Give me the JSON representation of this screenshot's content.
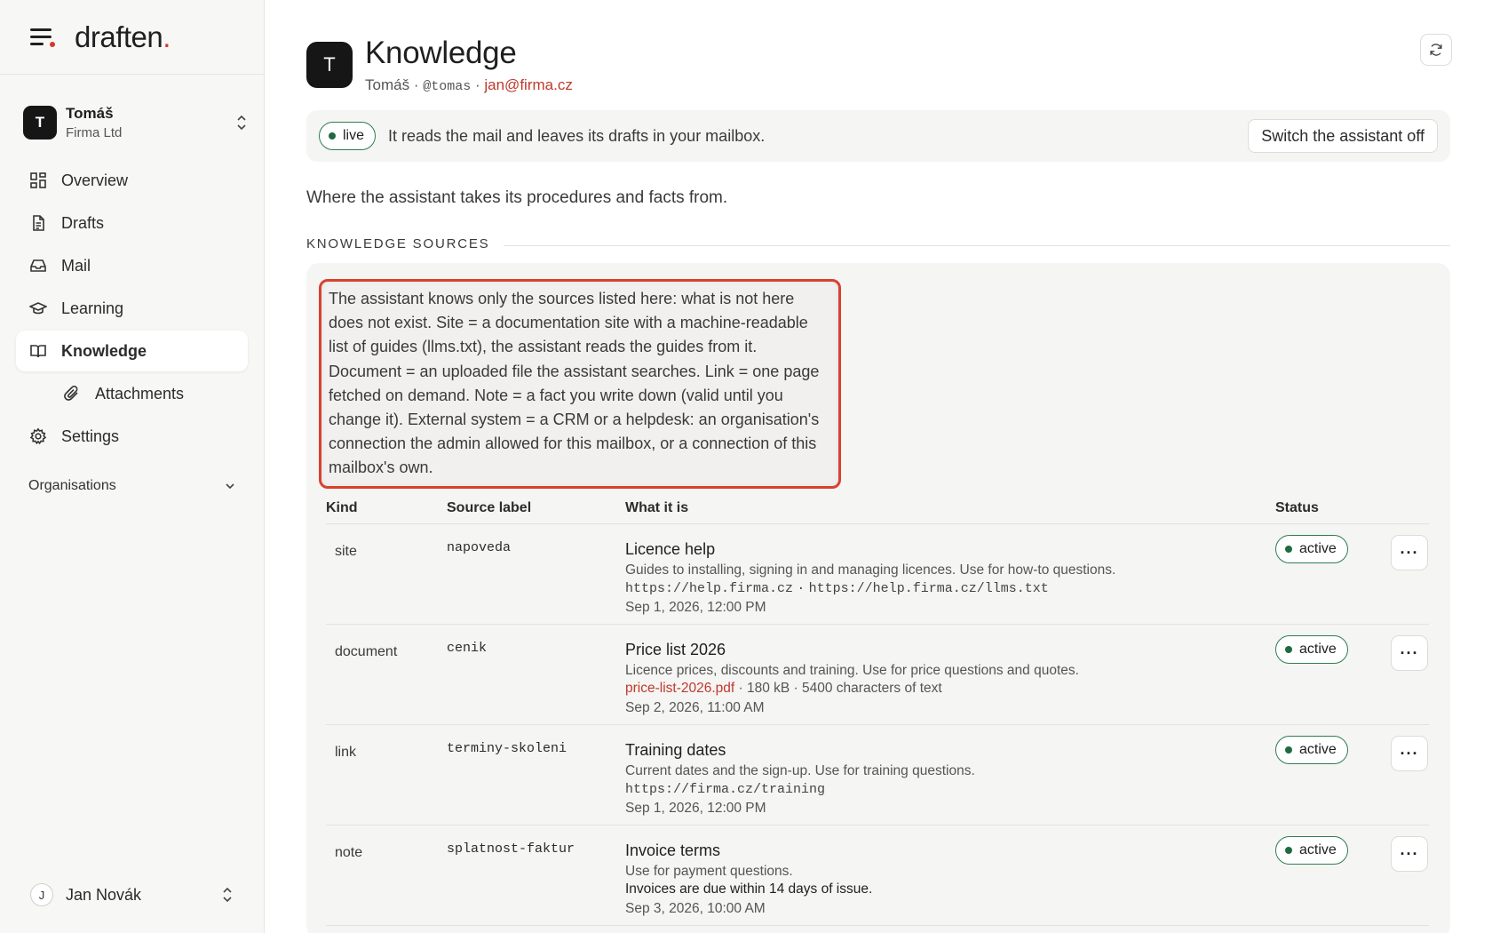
{
  "brand": {
    "name": "draften",
    "dot": "."
  },
  "account": {
    "initial": "T",
    "name": "Tomáš",
    "org": "Firma Ltd"
  },
  "nav": {
    "overview": "Overview",
    "drafts": "Drafts",
    "mail": "Mail",
    "learning": "Learning",
    "knowledge": "Knowledge",
    "attachments": "Attachments",
    "settings": "Settings",
    "organisations": "Organisations"
  },
  "user": {
    "initial": "J",
    "name": "Jan Novák"
  },
  "page": {
    "initial": "T",
    "title": "Knowledge",
    "owner": "Tomáš",
    "sep1": "·",
    "handle": "@tomas",
    "sep2": "·",
    "email": "jan@firma.cz"
  },
  "live": {
    "badge": "live",
    "text": "It reads the mail and leaves its drafts in your mailbox.",
    "switch_label": "Switch the assistant off"
  },
  "lead": "Where the assistant takes its procedures and facts from.",
  "section_label": "KNOWLEDGE SOURCES",
  "note": "The assistant knows only the sources listed here: what is not here does not exist. Site = a documentation site with a machine-readable list of guides (llms.txt), the assistant reads the guides from it. Document = an uploaded file the assistant searches. Link = one page fetched on demand. Note = a fact you write down (valid until you change it). External system = a CRM or a helpdesk: an organisation's connection the admin allowed for this mailbox, or a connection of this mailbox's own.",
  "table": {
    "headers": {
      "kind": "Kind",
      "label": "Source label",
      "what": "What it is",
      "status": "Status"
    },
    "rows": [
      {
        "kind": "site",
        "label": "napoveda",
        "title": "Licence help",
        "desc": "Guides to installing, signing in and managing licences. Use for how-to questions.",
        "url1": "https://help.firma.cz",
        "url_sep": "·",
        "url2": "https://help.firma.cz/llms.txt",
        "date": "Sep 1, 2026, 12:00 PM",
        "status": "active",
        "more": "···"
      },
      {
        "kind": "document",
        "label": "cenik",
        "title": "Price list 2026",
        "desc": "Licence prices, discounts and training. Use for price questions and quotes.",
        "file": "price-list-2026.pdf",
        "file_meta": " · 180 kB · 5400 characters of text",
        "date": "Sep 2, 2026, 11:00 AM",
        "status": "active",
        "more": "···"
      },
      {
        "kind": "link",
        "label": "terminy-skoleni",
        "title": "Training dates",
        "desc": "Current dates and the sign-up. Use for training questions.",
        "url1": "https://firma.cz/training",
        "date": "Sep 1, 2026, 12:00 PM",
        "status": "active",
        "more": "···"
      },
      {
        "kind": "note",
        "label": "splatnost-faktur",
        "title": "Invoice terms",
        "desc": "Use for payment questions.",
        "fact": "Invoices are due within 14 days of issue.",
        "date": "Sep 3, 2026, 10:00 AM",
        "status": "active",
        "more": "···"
      }
    ]
  },
  "colors": {
    "accent": "#d23a2c",
    "link": "#c0392b",
    "status_green": "#2f7d4f"
  }
}
